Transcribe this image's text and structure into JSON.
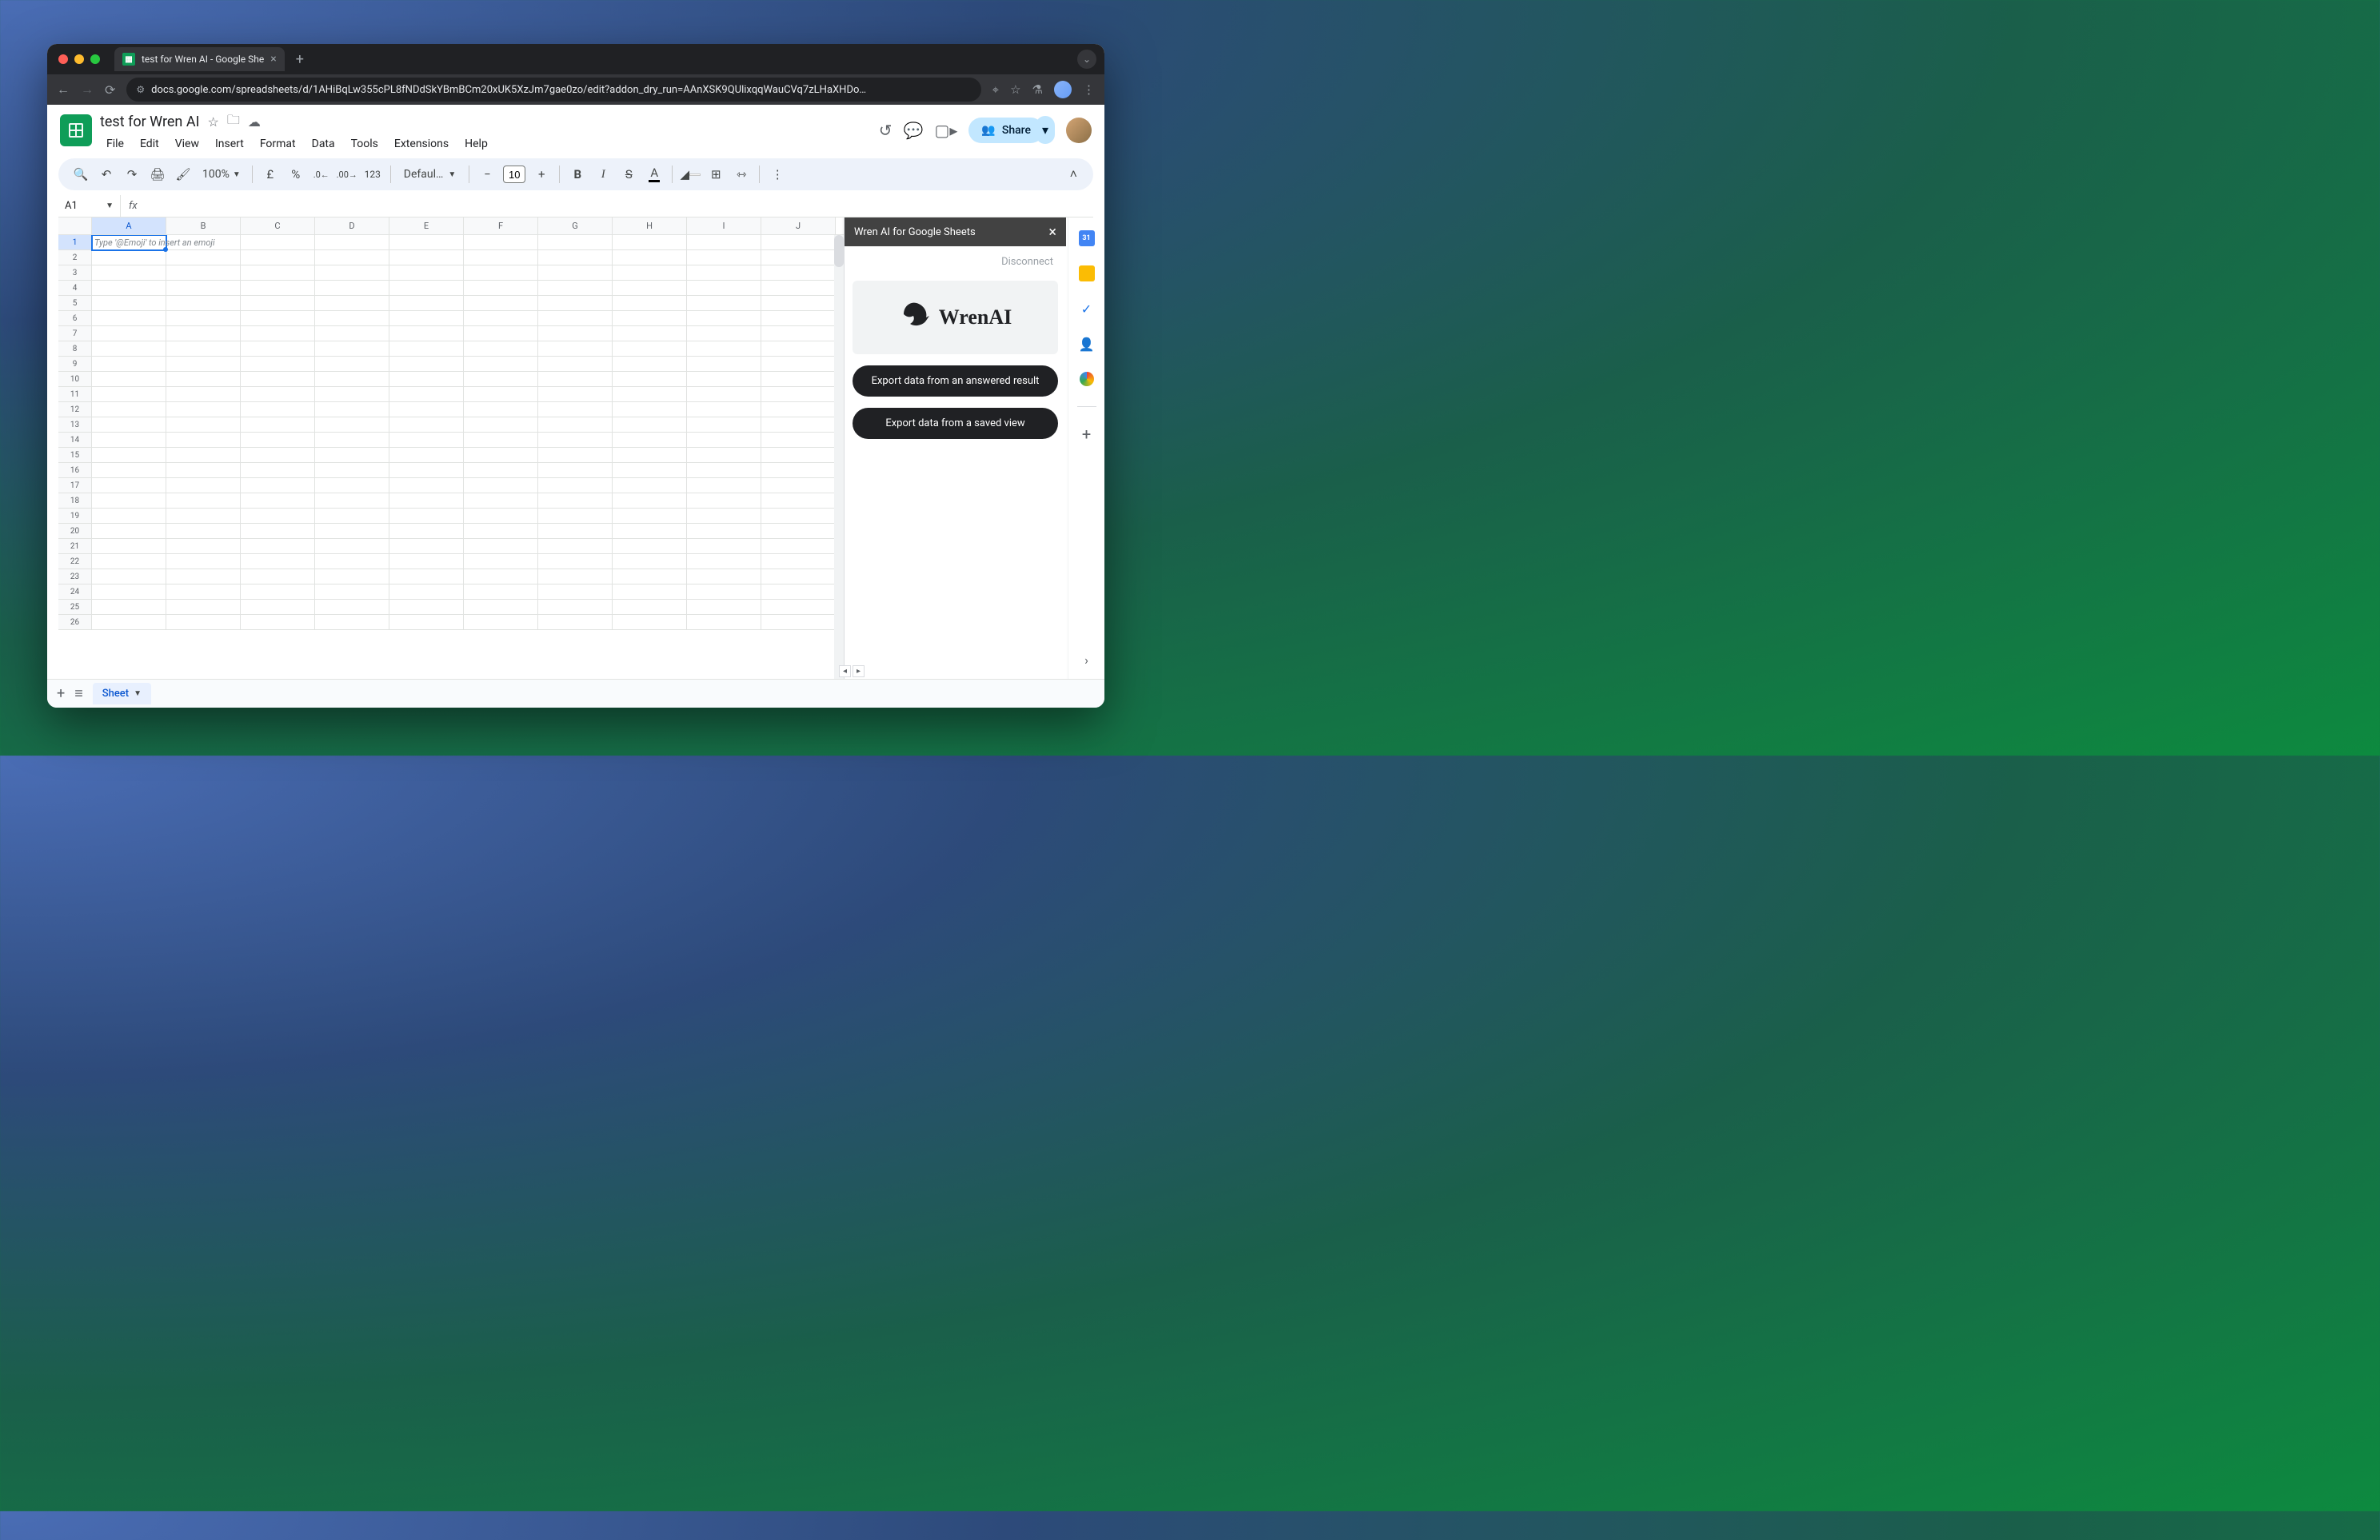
{
  "browser": {
    "tab_title": "test for Wren AI - Google She",
    "url": "docs.google.com/spreadsheets/d/1AHiBqLw355cPL8fNDdSkYBmBCm20xUK5XzJm7gae0zo/edit?addon_dry_run=AAnXSK9QUlixqqWauCVq7zLHaXHDo…"
  },
  "doc": {
    "title": "test for Wren AI"
  },
  "menus": [
    "File",
    "Edit",
    "View",
    "Insert",
    "Format",
    "Data",
    "Tools",
    "Extensions",
    "Help"
  ],
  "toolbar": {
    "zoom": "100%",
    "currency": "£",
    "percent": "%",
    "dec_dec": ".0",
    "inc_dec": ".00",
    "numfmt": "123",
    "font": "Defaul…",
    "fontsize": "10",
    "bold": "B",
    "italic": "I",
    "strike": "S",
    "textcolor": "A"
  },
  "namebox": "A1",
  "cell_hint": "Type '@Emoji' to insert an emoji",
  "columns": [
    "A",
    "B",
    "C",
    "D",
    "E",
    "F",
    "G",
    "H",
    "I",
    "J"
  ],
  "rows": [
    1,
    2,
    3,
    4,
    5,
    6,
    7,
    8,
    9,
    10,
    11,
    12,
    13,
    14,
    15,
    16,
    17,
    18,
    19,
    20,
    21,
    22,
    23,
    24,
    25,
    26
  ],
  "share_label": "Share",
  "sheet_tab": "Sheet",
  "panel": {
    "title": "Wren AI for Google Sheets",
    "disconnect": "Disconnect",
    "logo_text": "WrenAI",
    "btn1": "Export data from an answered result",
    "btn2": "Export data from a saved view"
  },
  "rail": {
    "cal": "31"
  }
}
